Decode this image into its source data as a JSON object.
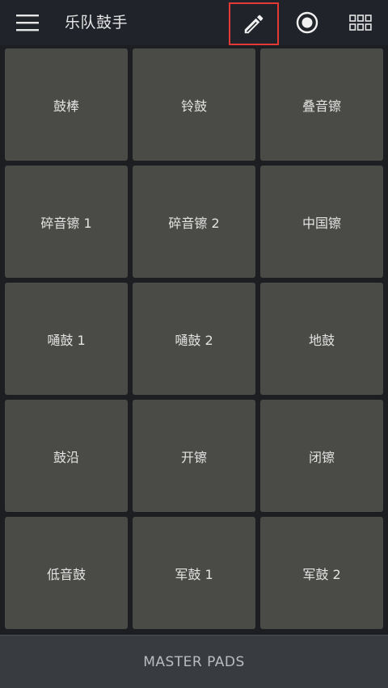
{
  "app": {
    "title": "乐队鼓手"
  },
  "toolbar": {
    "menu_icon": "hamburger-menu-icon",
    "edit_icon": "pencil-icon",
    "record_icon": "record-icon",
    "grid_icon": "grid-view-icon",
    "edit_highlight_color": "#e53935"
  },
  "pads": [
    {
      "label": "鼓棒"
    },
    {
      "label": "铃鼓"
    },
    {
      "label": "叠音镲"
    },
    {
      "label": "碎音镲 1"
    },
    {
      "label": "碎音镲 2"
    },
    {
      "label": "中国镲"
    },
    {
      "label": "嗵鼓 1"
    },
    {
      "label": "嗵鼓 2"
    },
    {
      "label": "地鼓"
    },
    {
      "label": "鼓沿"
    },
    {
      "label": "开镲"
    },
    {
      "label": "闭镲"
    },
    {
      "label": "低音鼓"
    },
    {
      "label": "军鼓 1"
    },
    {
      "label": "军鼓 2"
    }
  ],
  "bottom": {
    "master_label": "MASTER PADS"
  },
  "colors": {
    "background": "#1c1e22",
    "topbar": "#202329",
    "pad": "#4a4b46",
    "pad_text": "#e2e2e2",
    "bottom_bar": "#383b3f"
  }
}
